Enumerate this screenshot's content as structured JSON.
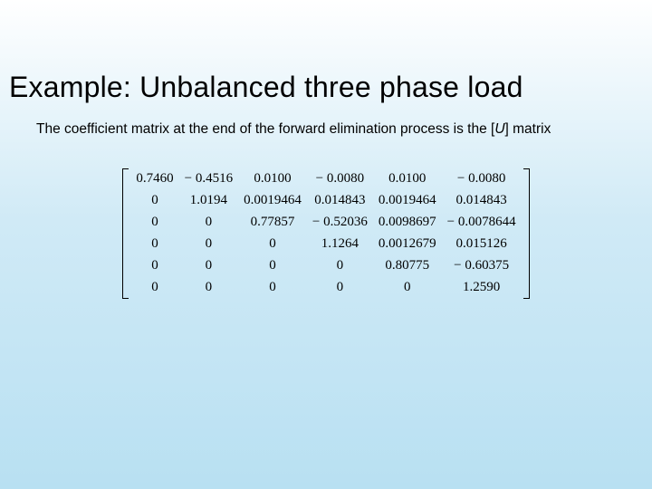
{
  "title": "Example: Unbalanced three phase load",
  "body_pre": "The coefficient matrix at the end of the forward elimination process is the [",
  "body_u": "U",
  "body_post": "] matrix",
  "matrix": {
    "rows": [
      [
        "0.7460",
        "− 0.4516",
        "0.0100",
        "− 0.0080",
        "0.0100",
        "− 0.0080"
      ],
      [
        "0",
        "1.0194",
        "0.0019464",
        "0.014843",
        "0.0019464",
        "0.014843"
      ],
      [
        "0",
        "0",
        "0.77857",
        "− 0.52036",
        "0.0098697",
        "− 0.0078644"
      ],
      [
        "0",
        "0",
        "0",
        "1.1264",
        "0.0012679",
        "0.015126"
      ],
      [
        "0",
        "0",
        "0",
        "0",
        "0.80775",
        "− 0.60375"
      ],
      [
        "0",
        "0",
        "0",
        "0",
        "0",
        "1.2590"
      ]
    ]
  }
}
